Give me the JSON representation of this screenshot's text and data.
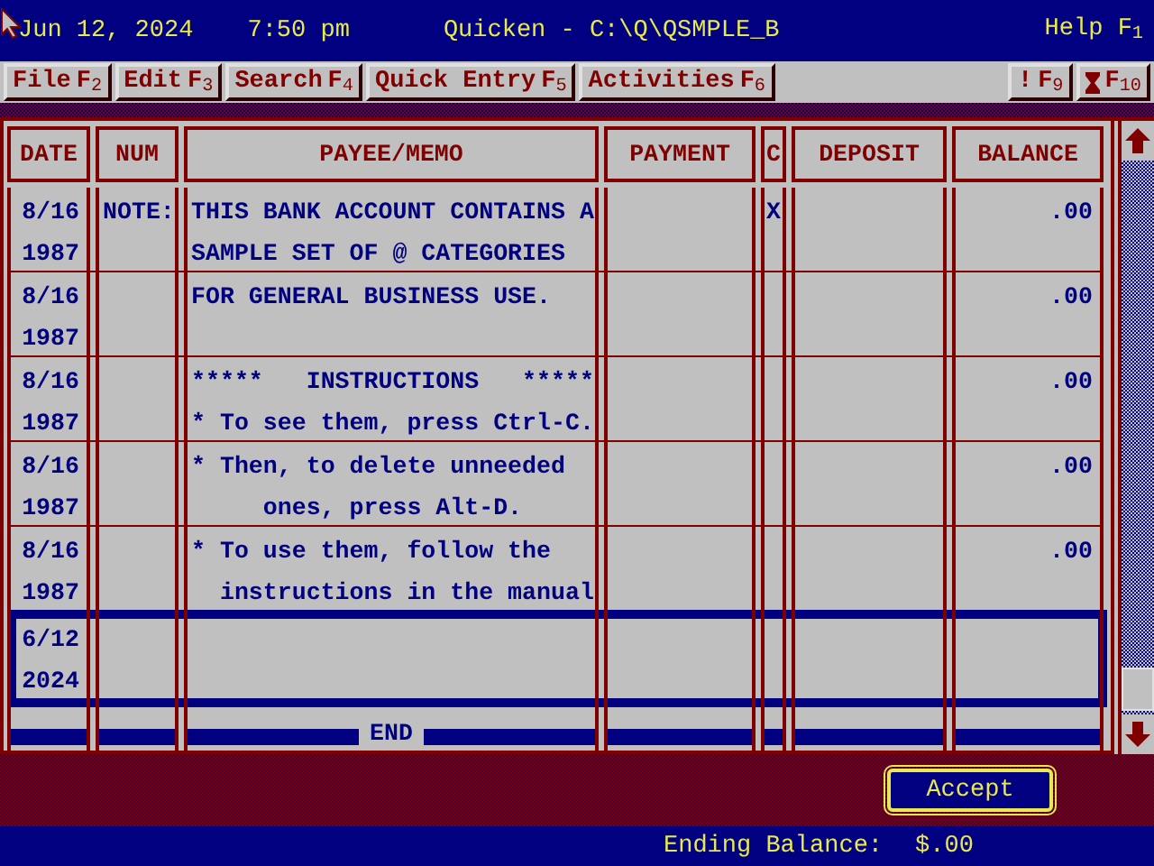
{
  "header": {
    "date": "Jun 12, 2024",
    "time": "7:50 pm",
    "title": "Quicken - C:\\Q\\QSMPLE_B",
    "help": "Help",
    "help_key": "F$_{1}$"
  },
  "menu": [
    {
      "kind": "text",
      "label": "File",
      "key": "F$_{2}$"
    },
    {
      "kind": "text",
      "label": "Edit",
      "key": "F$_{3}$"
    },
    {
      "kind": "text",
      "label": "Search",
      "key": "F$_{4}$"
    },
    {
      "kind": "text",
      "label": "Quick Entry",
      "key": "F$_{5}$"
    },
    {
      "kind": "text",
      "label": "Activities",
      "key": "F$_{6}$"
    }
  ],
  "menu_right": [
    {
      "kind": "text",
      "label": "!",
      "key": "F$_{9}$"
    },
    {
      "kind": "icon",
      "key": "F$_{10}$"
    }
  ],
  "register": {
    "columns": [
      "DATE",
      "NUM",
      "PAYEE/MEMO",
      "PAYMENT",
      "C",
      "DEPOSIT",
      "BALANCE"
    ],
    "rows": [
      {
        "date": "8/16",
        "year": "1987",
        "num": "NOTE:",
        "lines": [
          "THIS BANK ACCOUNT CONTAINS A",
          "SAMPLE SET OF @ CATEGORIES"
        ],
        "cleared": "X",
        "balance": ".00",
        "selected": false
      },
      {
        "date": "8/16",
        "year": "1987",
        "lines": [
          "FOR GENERAL BUSINESS USE."
        ],
        "balance": ".00",
        "selected": false
      },
      {
        "date": "8/16",
        "year": "1987",
        "lines": [
          "*****   INSTRUCTIONS   *****",
          "* To see them, press Ctrl-C."
        ],
        "balance": ".00",
        "selected": false
      },
      {
        "date": "8/16",
        "year": "1987",
        "lines": [
          "* Then, to delete unneeded",
          "     ones, press Alt-D."
        ],
        "balance": ".00",
        "selected": false
      },
      {
        "date": "8/16",
        "year": "1987",
        "lines": [
          "* To use them, follow the",
          "  instructions in the manual"
        ],
        "balance": ".00",
        "selected": false
      },
      {
        "date": "6/12",
        "year": "2024",
        "lines": [],
        "selected": true
      }
    ],
    "end_marker": "END"
  },
  "accept_button": "Accept",
  "status": {
    "label": "Ending Balance:",
    "value": "$.00"
  }
}
